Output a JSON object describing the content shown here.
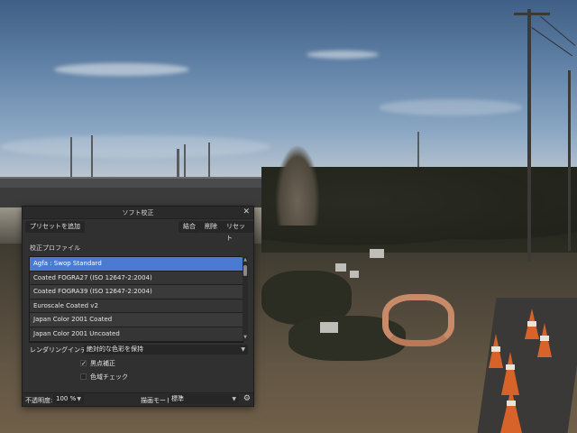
{
  "dialog": {
    "title": "ソフト校正",
    "toolbar": {
      "add_preset": "プリセットを追加",
      "merge": "結合",
      "delete": "削除",
      "reset": "リセット"
    },
    "profile_label": "校正プロファイル",
    "profiles": [
      "Agfa : Swop Standard",
      "Coated FOGRA27 (ISO 12647-2:2004)",
      "Coated FOGRA39 (ISO 12647-2:2004)",
      "Euroscale Coated v2",
      "Japan Color 2001 Coated",
      "Japan Color 2001 Uncoated"
    ],
    "selected_profile_index": 0,
    "rendering_intent_label": "レンダリングインテント:",
    "rendering_intent_value": "絶対的な色彩を保持",
    "black_point_label": "黒点補正",
    "black_point_checked": true,
    "gamut_check_label": "色域チェック",
    "gamut_check_checked": false,
    "opacity_label": "不透明度:",
    "opacity_value": "100 %",
    "blend_mode_label": "描画モード:",
    "blend_mode_value": "標準"
  },
  "icons": {
    "close": "close-icon",
    "gear": "gear-icon",
    "scroll_up": "chevron-up-icon",
    "scroll_down": "chevron-down-icon"
  },
  "colors": {
    "selection": "#4a7bd0",
    "panel": "#303030"
  }
}
